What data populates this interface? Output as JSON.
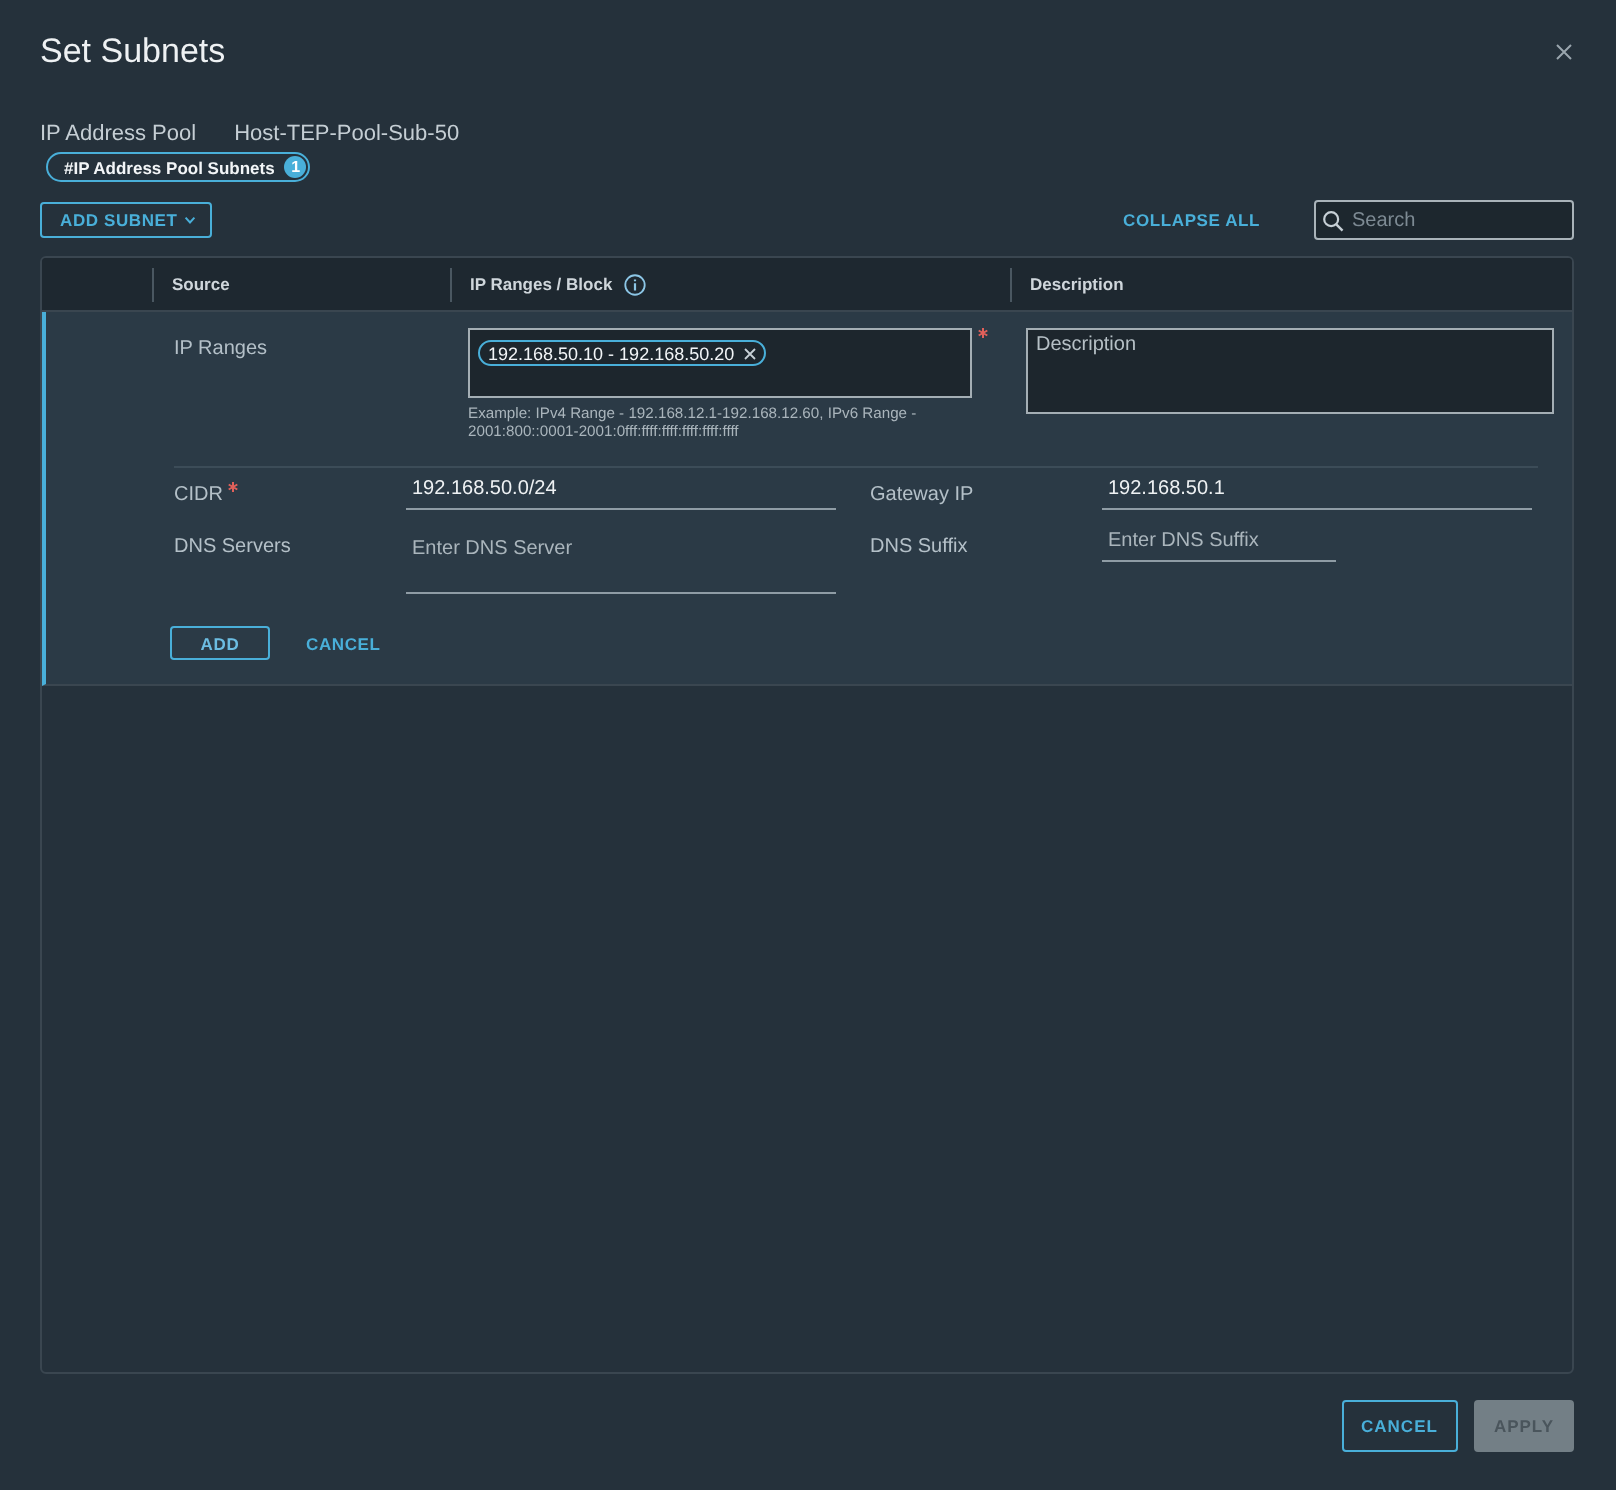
{
  "dialog": {
    "title": "Set Subnets"
  },
  "pool": {
    "label": "IP Address Pool",
    "value": "Host-TEP-Pool-Sub-50"
  },
  "tag": {
    "label": "#IP Address Pool Subnets",
    "badge": "1"
  },
  "toolbar": {
    "add_button": "ADD SUBNET",
    "collapse_all": "COLLAPSE ALL",
    "search": {
      "placeholder": "Search"
    }
  },
  "table": {
    "columns": [
      {
        "label": "Source",
        "info": false
      },
      {
        "label": "IP Ranges / Block",
        "info": true
      },
      {
        "label": "Description",
        "info": false
      }
    ],
    "row": {
      "source": "IP Ranges",
      "ip_ranges": {
        "chips": [
          "192.168.50.10 - 192.168.50.20"
        ],
        "required": true,
        "help": "Example: IPv4 Range - 192.168.12.1-192.168.12.60, IPv6 Range - 2001:800::0001-2001:0fff:ffff:ffff:ffff:ffff:ffff"
      },
      "description": {
        "placeholder": "Description"
      },
      "fields": [
        {
          "kind": "line",
          "label": "CIDR",
          "required": true,
          "value": "192.168.50.0/24"
        },
        {
          "kind": "line",
          "label": "Gateway IP",
          "required": false,
          "value": "192.168.50.1"
        },
        {
          "kind": "multiline",
          "label": "DNS Servers",
          "required": false,
          "placeholder": "Enter DNS Server"
        },
        {
          "kind": "short",
          "label": "DNS Suffix",
          "required": false,
          "placeholder": "Enter DNS Suffix"
        }
      ],
      "actions": {
        "add": "ADD",
        "cancel": "CANCEL"
      }
    }
  },
  "footer": {
    "buttons": [
      {
        "label": "CANCEL",
        "disabled": false
      },
      {
        "label": "APPLY",
        "disabled": true
      }
    ]
  }
}
